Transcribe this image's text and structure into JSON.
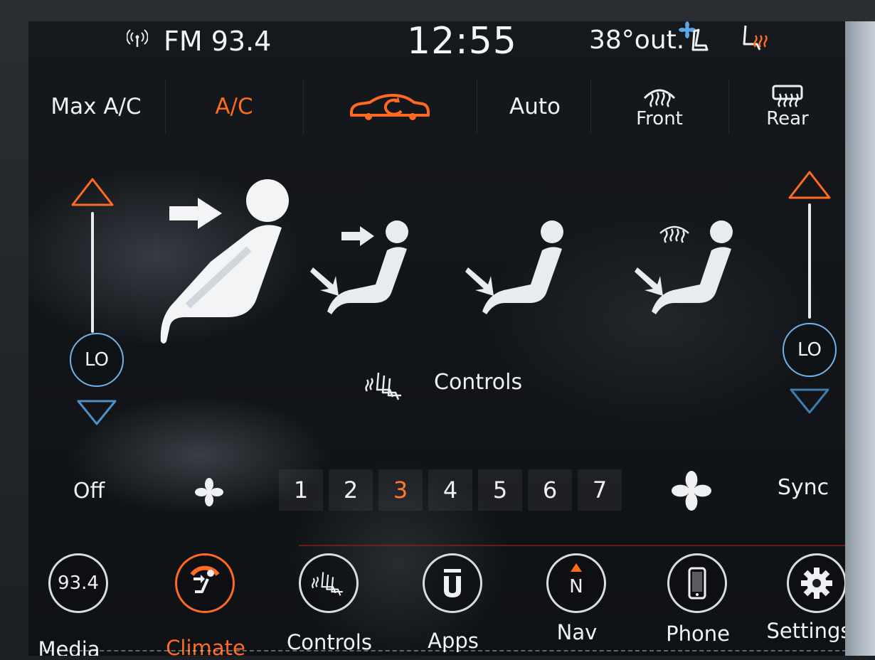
{
  "status": {
    "radio": "FM 93.4",
    "time": "12:55",
    "outside_temp": "38°out."
  },
  "top_controls": {
    "max_ac": "Max A/C",
    "ac": "A/C",
    "recirc_icon": "recirculation-car-icon",
    "auto": "Auto",
    "front": "Front",
    "rear": "Rear"
  },
  "temp_left": {
    "value": "LO"
  },
  "temp_right": {
    "value": "LO"
  },
  "airflow_modes": [
    "panel",
    "bi-level",
    "floor",
    "floor-defrost"
  ],
  "center": {
    "controls": "Controls"
  },
  "fan": {
    "off": "Off",
    "levels": [
      "1",
      "2",
      "3",
      "4",
      "5",
      "6",
      "7"
    ],
    "selected": "3",
    "sync": "Sync"
  },
  "nav": {
    "media_badge": "93.4",
    "media": "Media",
    "climate": "Climate",
    "controls": "Controls",
    "apps": "Apps",
    "nav": "Nav",
    "nav_badge": "N",
    "phone": "Phone",
    "settings": "Settings"
  },
  "colors": {
    "accent": "#ff6a1f",
    "lo_ring": "#6fb3ea",
    "text": "#eef0f2"
  }
}
